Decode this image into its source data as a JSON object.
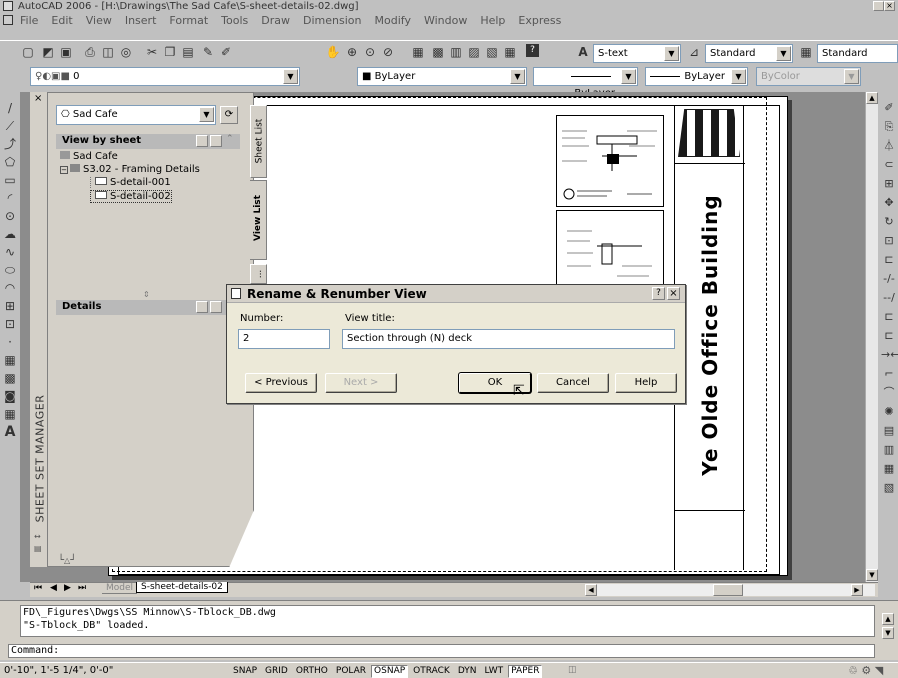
{
  "app": {
    "title": "AutoCAD 2006 - [H:\\Drawings\\The Sad Cafe\\S-sheet-details-02.dwg]"
  },
  "menu": [
    "File",
    "Edit",
    "View",
    "Insert",
    "Format",
    "Tools",
    "Draw",
    "Dimension",
    "Modify",
    "Window",
    "Help",
    "Express"
  ],
  "toolbar": {
    "text_style": "S-text",
    "dim_style": "Standard",
    "table_style": "Standard",
    "layer": "0",
    "color": "ByLayer",
    "linetype": "ByLayer",
    "lineweight": "ByLayer",
    "plotstyle": "ByColor"
  },
  "ssm": {
    "vertical_title": "SHEET SET MANAGER",
    "sheet_set": "Sad Cafe",
    "panel_title": "View by sheet",
    "tree": {
      "root": "Sad Cafe",
      "sheet": "S3.02 - Framing Details",
      "view1": "S-detail-001",
      "view2": "S-detail-002"
    },
    "tabs": [
      "Sheet List",
      "View List",
      "..."
    ],
    "details_title": "Details"
  },
  "dialog": {
    "title": "Rename & Renumber View",
    "number_label": "Number:",
    "number_value": "2",
    "viewtitle_label": "View title:",
    "viewtitle_value": "Section through (N) deck",
    "prev": "< Previous",
    "next": "Next >",
    "ok": "OK",
    "cancel": "Cancel",
    "help": "Help"
  },
  "drawing": {
    "building_title": "Ye Olde Office Building"
  },
  "layout_tabs": {
    "model": "Model",
    "layout": "S-sheet-details-02"
  },
  "command": {
    "line1": "FD\\_Figures\\Dwgs\\SS Minnow\\S-Tblock_DB.dwg",
    "line2": "\"S-Tblock_DB\" loaded.",
    "prompt": "Command:"
  },
  "status": {
    "coords": "0'-10\",  1'-5 1/4\", 0'-0\"",
    "toggles": [
      "SNAP",
      "GRID",
      "ORTHO",
      "POLAR",
      "OSNAP",
      "OTRACK",
      "DYN",
      "LWT",
      "PAPER"
    ]
  }
}
